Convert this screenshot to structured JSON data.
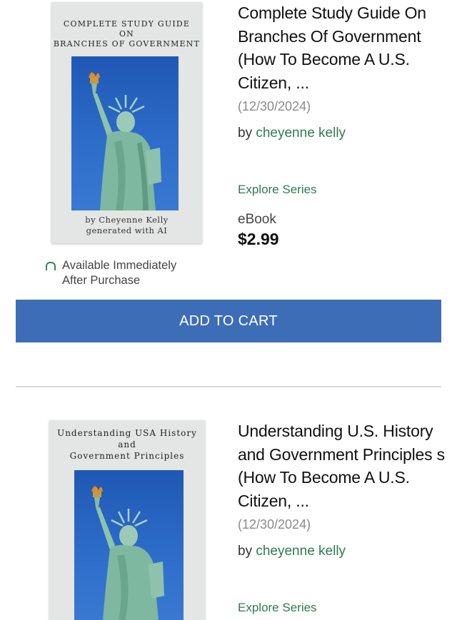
{
  "products": [
    {
      "cover_title": "COMPLETE STUDY GUIDE\nON\nBRANCHES OF GOVERNMENT",
      "cover_author": "by Cheyenne Kelly\ngenerated with AI",
      "title": "Complete Study Guide On Branches Of Government (How To Become A U.S. Citizen, ...",
      "date": "(12/30/2024)",
      "by_prefix": "by ",
      "author": "cheyenne kelly",
      "explore": "Explore Series",
      "format": "eBook",
      "price": "$2.99",
      "availability": "Available Immediately\nAfter Purchase",
      "add_to_cart": "ADD TO CART"
    },
    {
      "cover_title": "Understanding USA History\nand\nGovernment Principles",
      "title": "Understanding U.S. History and Government Principles s (How To Become A U.S. Citizen, ...",
      "date": "(12/30/2024)",
      "by_prefix": "by ",
      "author": "cheyenne kelly",
      "explore": "Explore Series"
    }
  ],
  "icons": {
    "wishlist": "heart-icon",
    "availability": "arc-icon"
  },
  "colors": {
    "accent_green": "#2f7a4f",
    "button_blue": "#3e6db7",
    "muted_text": "#8a8a8a"
  }
}
